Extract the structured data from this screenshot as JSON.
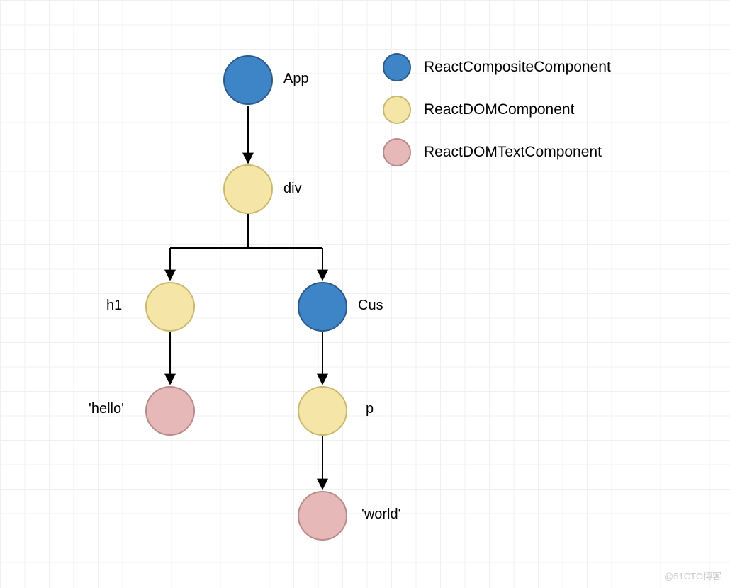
{
  "nodes": {
    "app": {
      "label": "App",
      "type": "composite"
    },
    "div": {
      "label": "div",
      "type": "dom"
    },
    "h1": {
      "label": "h1",
      "type": "dom"
    },
    "cus": {
      "label": "Cus",
      "type": "composite"
    },
    "hello": {
      "label": "'hello'",
      "type": "text"
    },
    "p": {
      "label": "p",
      "type": "dom"
    },
    "world": {
      "label": "'world'",
      "type": "text"
    }
  },
  "legend": {
    "composite": "ReactCompositeComponent",
    "dom": "ReactDOMComponent",
    "text": "ReactDOMTextComponent"
  },
  "colors": {
    "composite": "#3d85c6",
    "dom": "#f5e6a8",
    "text": "#e6b8b8"
  },
  "edges": [
    {
      "from": "app",
      "to": "div"
    },
    {
      "from": "div",
      "to": [
        "h1",
        "cus"
      ]
    },
    {
      "from": "h1",
      "to": "hello"
    },
    {
      "from": "cus",
      "to": "p"
    },
    {
      "from": "p",
      "to": "world"
    }
  ],
  "watermark": "@51CTO博客"
}
